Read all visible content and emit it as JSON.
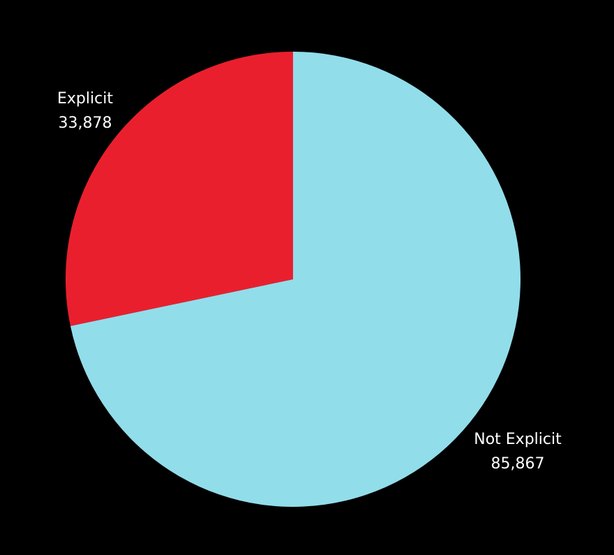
{
  "chart_data": {
    "type": "pie",
    "title": "",
    "slices": [
      {
        "label": "Not Explicit",
        "value": 85867,
        "value_label": "85,867",
        "color": "#92DDEA"
      },
      {
        "label": "Explicit",
        "value": 33878,
        "value_label": "33,878",
        "color": "#EA1F2E"
      }
    ],
    "start_angle": "12 o'clock",
    "direction": "clockwise",
    "legend": "none",
    "background_color": "#000000",
    "label_color": "#FFFFFF"
  }
}
